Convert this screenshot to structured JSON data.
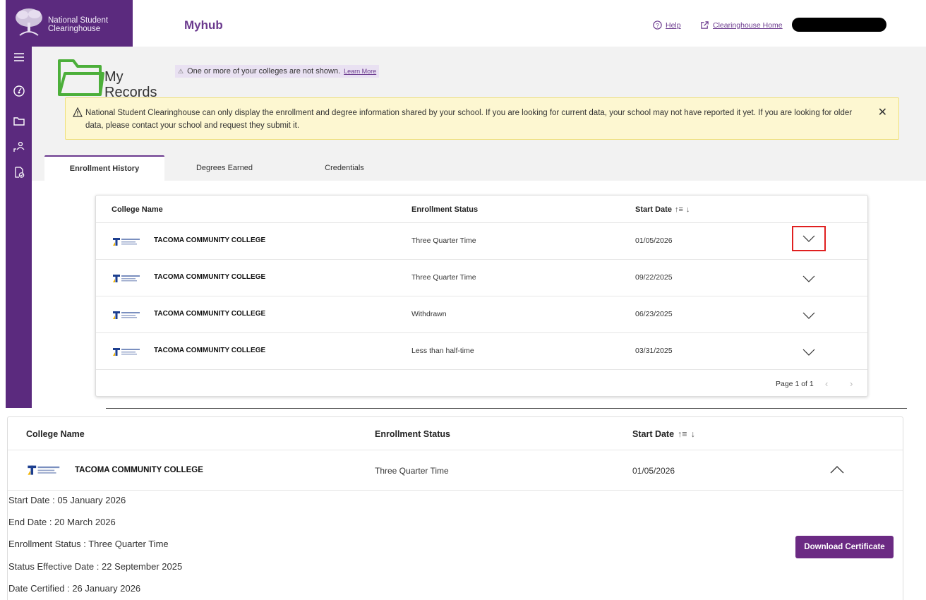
{
  "header": {
    "brand_line1": "National Student",
    "brand_line2": "Clearinghouse",
    "app_title": "Myhub",
    "help_label": "Help",
    "home_label": "Clearinghouse Home"
  },
  "sidebar": {
    "icons": [
      "menu-icon",
      "dashboard-icon",
      "folder-icon",
      "person-icon",
      "document-check-icon"
    ]
  },
  "page": {
    "title_line1": "My",
    "title_line2": "Records",
    "hidden_notice": "One or more of your colleges are not shown.",
    "learn_more": "Learn More",
    "alert_text": "National Student Clearinghouse can only display the enrollment and degree information shared by your school. If you are looking for current data, your school may not have reported it yet. If you are looking for older data, please contact your school and request they submit it.",
    "alert_close": "✕"
  },
  "tabs": [
    {
      "label": "Enrollment History",
      "active": true
    },
    {
      "label": "Degrees Earned",
      "active": false
    },
    {
      "label": "Credentials",
      "active": false
    }
  ],
  "table": {
    "columns": [
      "College Name",
      "Enrollment Status",
      "Start Date"
    ],
    "rows": [
      {
        "college": "TACOMA COMMUNITY COLLEGE",
        "status": "Three Quarter Time",
        "start": "01/05/2026"
      },
      {
        "college": "TACOMA COMMUNITY COLLEGE",
        "status": "Three Quarter Time",
        "start": "09/22/2025"
      },
      {
        "college": "TACOMA COMMUNITY COLLEGE",
        "status": "Withdrawn",
        "start": "06/23/2025"
      },
      {
        "college": "TACOMA COMMUNITY COLLEGE",
        "status": "Less than half-time",
        "start": "03/31/2025"
      }
    ],
    "pagination": "Page 1 of 1",
    "prev": "‹",
    "next": "›"
  },
  "expanded": {
    "columns": [
      "College Name",
      "Enrollment Status",
      "Start Date"
    ],
    "row": {
      "college": "TACOMA COMMUNITY COLLEGE",
      "status": "Three Quarter Time",
      "start": "01/05/2026"
    },
    "details": [
      "Start Date : 05 January 2026",
      "End Date : 20 March 2026",
      "Enrollment Status : Three Quarter Time",
      "Status Effective Date : 22 September 2025",
      "Date Certified : 26 January 2026"
    ],
    "download_label": "Download Certificate"
  },
  "colors": {
    "brand_purple": "#5b2a7e",
    "button_purple": "#6b2a83",
    "alert_bg": "#fdf7d1",
    "highlight_red": "#e02020"
  }
}
